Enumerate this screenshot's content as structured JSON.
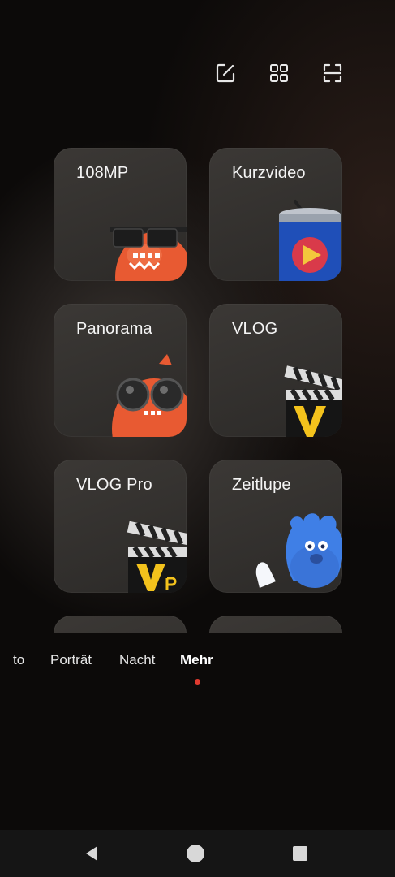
{
  "toolbar": {
    "icons": [
      "edit-icon",
      "grid-icon",
      "scan-icon"
    ]
  },
  "modes_grid": [
    {
      "label": "108MP",
      "art": "mascot-sunglasses"
    },
    {
      "label": "Kurzvideo",
      "art": "soda-can-play"
    },
    {
      "label": "Panorama",
      "art": "mascot-binoculars"
    },
    {
      "label": "VLOG",
      "art": "clapperboard-v"
    },
    {
      "label": "VLOG Pro",
      "art": "clapperboard-vpro"
    },
    {
      "label": "Zeitlupe",
      "art": "blue-mascot"
    }
  ],
  "mode_bar": {
    "items": [
      "to",
      "Porträt",
      "Nacht",
      "Mehr"
    ],
    "active": "Mehr",
    "indicator_color": "#e03a2f"
  },
  "nav": {
    "icons": [
      "back-icon",
      "home-icon",
      "recents-icon"
    ]
  }
}
